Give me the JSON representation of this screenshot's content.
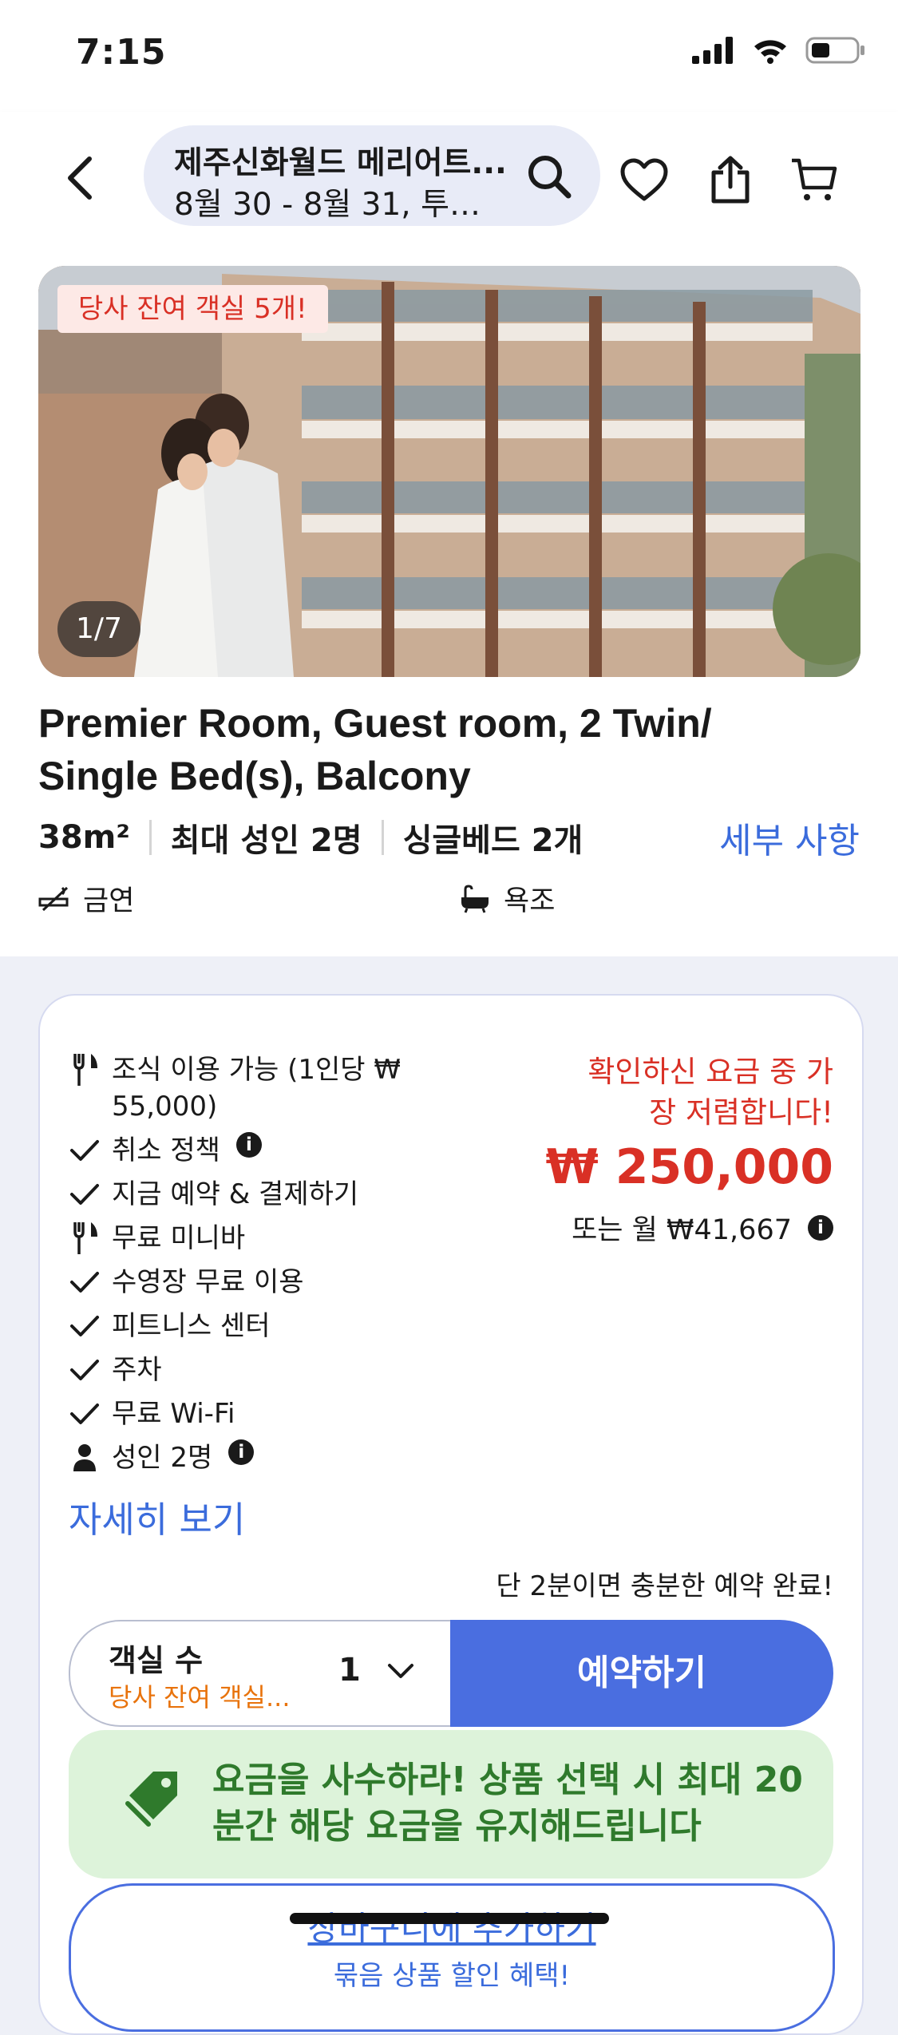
{
  "status_bar": {
    "time": "7:15"
  },
  "header": {
    "hotel_name": "제주신화월드 메리어트...",
    "trip_summary": "8월 30 - 8월 31, 투…"
  },
  "room": {
    "scarcity_badge": "당사 잔여 객실 5개!",
    "photo_counter": "1/7",
    "title": "Premier Room, Guest room, 2 Twin/ Single Bed(s), Balcony",
    "size": "38m²",
    "max_occupancy": "최대 성인 2명",
    "beds": "싱글베드 2개",
    "details_link": "세부 사항",
    "amenities": [
      {
        "icon": "no-smoking-icon",
        "label": "금연"
      },
      {
        "icon": "bathtub-icon",
        "label": "욕조"
      }
    ]
  },
  "offer": {
    "features": [
      {
        "icon": "utensils-icon",
        "label": "조식 이용 가능 (1인당 ₩ 55,000)",
        "info": false
      },
      {
        "icon": "check-icon",
        "label": "취소 정책",
        "info": true
      },
      {
        "icon": "check-icon",
        "label": "지금 예약 & 결제하기",
        "info": false
      },
      {
        "icon": "utensils-icon",
        "label": "무료 미니바",
        "info": false
      },
      {
        "icon": "check-icon",
        "label": "수영장 무료 이용",
        "info": false
      },
      {
        "icon": "check-icon",
        "label": "피트니스 센터",
        "info": false
      },
      {
        "icon": "check-icon",
        "label": "주차",
        "info": false
      },
      {
        "icon": "check-icon",
        "label": "무료 Wi-Fi",
        "info": false
      },
      {
        "icon": "person-icon",
        "label": "성인 2명",
        "info": true
      }
    ],
    "more_link": "자세히 보기",
    "lowest_price_note": "확인하신 요금 중 가장 저렴합니다!",
    "price": "₩ 250,000",
    "monthly_price": "또는 월 ₩41,667",
    "quick_note": "단 2분이면 충분한 예약 완료!",
    "room_count_label": "객실 수",
    "room_count_sub": "당사 잔여 객실...",
    "room_count_value": "1",
    "reserve_label": "예약하기",
    "hold_banner": "요금을 사수하라! 상품 선택 시 최대 20분간 해당 요금을 유지해드립니다",
    "cart_label": "장바구니에 추가하기",
    "cart_sub": "묶음 상품 할인 혜택!"
  },
  "colors": {
    "accent": "#4a6ee0",
    "link": "#3b6cdc",
    "alert": "#d93025",
    "hold_bg": "#ddf3da",
    "hold_text": "#2f7a2c",
    "page_bg": "#eef0f7"
  }
}
